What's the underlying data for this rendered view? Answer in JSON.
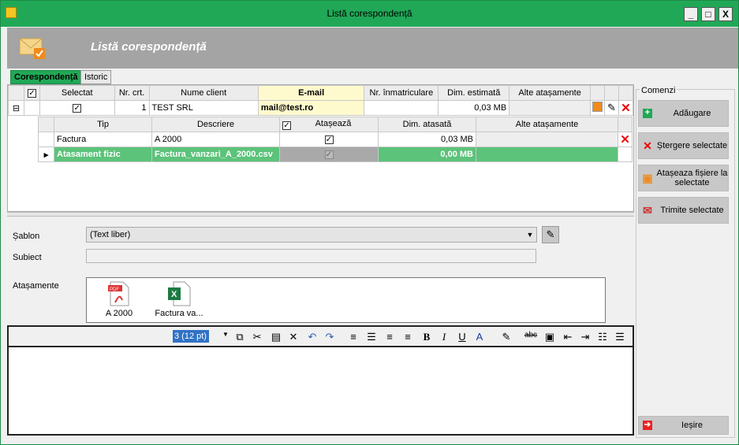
{
  "window": {
    "title": "Listă corespondență",
    "controls": [
      "_",
      "□",
      "X"
    ]
  },
  "header": {
    "title": "Listă corespondență"
  },
  "tabs": [
    {
      "label": "Corespondență",
      "active": true
    },
    {
      "label": "Istoric",
      "active": false
    }
  ],
  "grid": {
    "columns": [
      "Selectat",
      "Nr. crt.",
      "Nume client",
      "E-mail",
      "Nr. înmatriculare",
      "Dim. estimată",
      "Alte atașamente"
    ],
    "row": {
      "selected": "✓",
      "nr": "1",
      "client": "TEST SRL",
      "email": "mail@test.ro",
      "inmat": "",
      "dim": "0,03 MB",
      "alte": ""
    },
    "sub": {
      "columns": [
        "Tip",
        "Descriere",
        "Atașează",
        "Dim. atasată",
        "Alte atașamente"
      ],
      "rows": [
        {
          "tip": "Factura",
          "descriere": "A 2000",
          "ataseaza": "✓",
          "dim": "0,03 MB",
          "alte": ""
        },
        {
          "tip": "Atasament fizic",
          "descriere": "Factura_vanzari_A_2000.csv",
          "ataseaza": "✓",
          "dim": "0,00 MB",
          "alte": ""
        }
      ]
    }
  },
  "form": {
    "sablon_label": "Șablon",
    "sablon_value": "(Text liber)",
    "subiect_label": "Subiect",
    "subiect_value": "",
    "atasamente_label": "Atașamente",
    "files": [
      {
        "name": "A 2000",
        "type": "pdf-icon"
      },
      {
        "name": "Factura va...",
        "type": "excel-icon"
      }
    ]
  },
  "editor": {
    "font_size": "3 (12 pt)",
    "body": ""
  },
  "commands": {
    "group": "Comenzi",
    "add": "Adăugare",
    "delete": "Ștergere selectate",
    "attach": "Atașeaza fișiere la selectate",
    "send": "Trimite selectate",
    "exit": "Ieșire"
  },
  "colors": {
    "accent": "#21a857",
    "header": "#a4a4a4",
    "highlight": "#fffacd",
    "selected_row": "#5cc37a",
    "delete": "#e00000"
  }
}
